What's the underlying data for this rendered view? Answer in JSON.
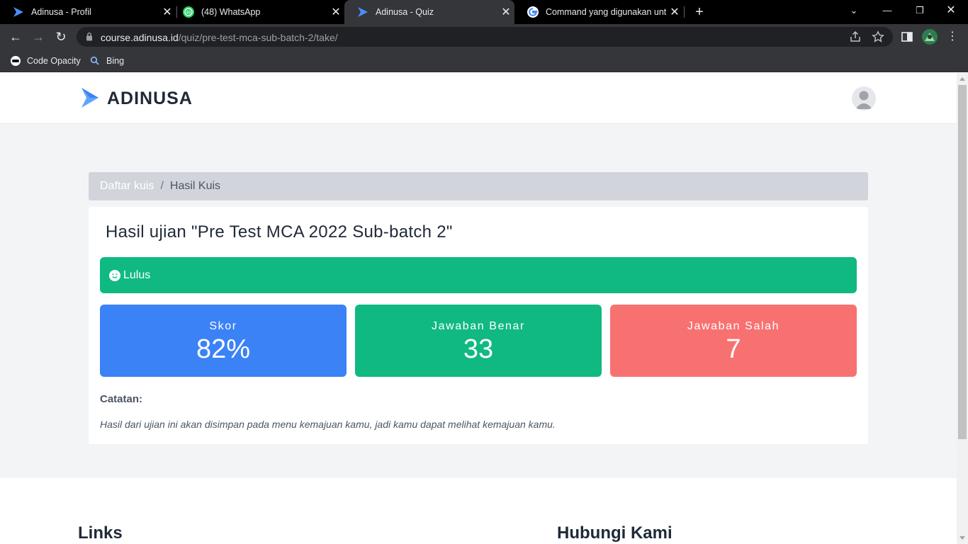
{
  "browser": {
    "tabs": [
      {
        "title": "Adinusa - Profil",
        "icon": "adinusa-logo-icon"
      },
      {
        "title": "(48) WhatsApp",
        "icon": "whatsapp-icon",
        "badge": "48"
      },
      {
        "title": "Adinusa - Quiz",
        "icon": "adinusa-logo-icon",
        "active": true
      },
      {
        "title": "Command yang digunakan untuk",
        "icon": "google-icon"
      }
    ],
    "new_tab": "+",
    "url_host": "course.adinusa.id",
    "url_path": "/quiz/pre-test-mca-sub-batch-2/take/",
    "bookmarks": [
      {
        "label": "Code Opacity",
        "icon": "code-opacity-icon"
      },
      {
        "label": "Bing",
        "icon": "search-icon"
      }
    ]
  },
  "header": {
    "brand": "ADINUSA",
    "accent": "#3b82f6"
  },
  "breadcrumb": {
    "link": "Daftar kuis",
    "separator": "/",
    "current": "Hasil Kuis"
  },
  "result": {
    "heading": "Hasil ujian \"Pre Test MCA 2022 Sub-batch 2\"",
    "status": "Lulus",
    "status_color": "#10b981",
    "stats": [
      {
        "label": "Skor",
        "value": "82%",
        "color": "#3b82f6"
      },
      {
        "label": "Jawaban Benar",
        "value": "33",
        "color": "#10b981"
      },
      {
        "label": "Jawaban Salah",
        "value": "7",
        "color": "#f87171"
      }
    ],
    "notes_title": "Catatan:",
    "notes_text": "Hasil dari ujian ini akan disimpan pada menu kemajuan kamu, jadi kamu dapat melihat kemajuan kamu."
  },
  "footer": {
    "links_title": "Links",
    "contact_title": "Hubungi Kami"
  }
}
